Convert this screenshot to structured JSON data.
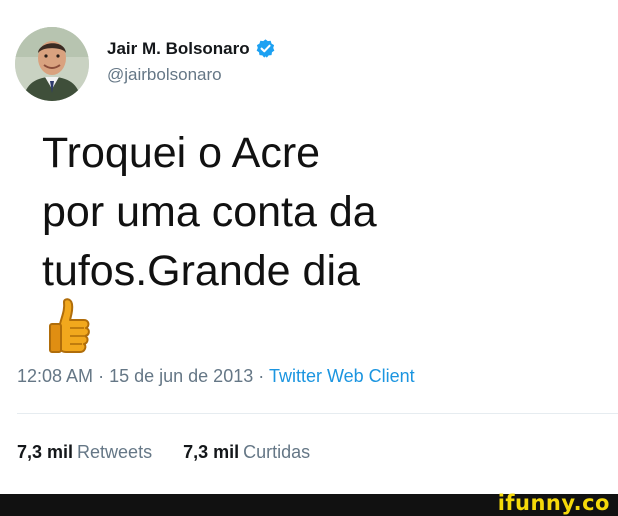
{
  "user": {
    "display_name": "Jair M. Bolsonaro",
    "handle": "@jairbolsonaro",
    "verified": true,
    "avatar_icon": "profile-photo"
  },
  "tweet": {
    "lines": [
      "Troquei o Acre",
      "por uma conta da",
      "tufos.Grande dia"
    ],
    "emoji_icon": "thumbs-up-icon"
  },
  "meta": {
    "time": "12:08 AM",
    "separator": "·",
    "date": "15 de jun de 2013",
    "client": "Twitter Web Client"
  },
  "stats": {
    "retweets_value": "7,3 mil",
    "retweets_label": "Retweets",
    "likes_value": "7,3 mil",
    "likes_label": "Curtidas"
  },
  "watermark": {
    "text": "ifunny.co"
  },
  "colors": {
    "verified": "#1da1f2",
    "link": "#1b95e0",
    "secondary_text": "#657786",
    "watermark": "#f5d90a"
  }
}
